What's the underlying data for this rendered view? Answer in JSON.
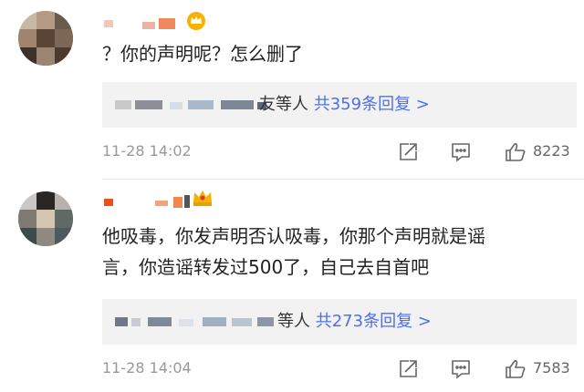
{
  "comments": [
    {
      "text_lines": [
        "？你的声明呢？怎么删了"
      ],
      "reply": {
        "partial_text": "友等人",
        "count_text": "共359条回复 >"
      },
      "timestamp": "11-28 14:02",
      "likes": "8223",
      "icons": {
        "share": "share-icon",
        "comment": "comment-icon",
        "like": "like-icon"
      }
    },
    {
      "text_lines": [
        "他吸毒，你发声明否认吸毒，你那个声明就是谣",
        "言，你造谣转发过500了，自己去自首吧"
      ],
      "reply": {
        "partial_text": "等人",
        "count_text": "共273条回复 >"
      },
      "timestamp": "11-28 14:04",
      "likes": "7583",
      "icons": {
        "share": "share-icon",
        "comment": "comment-icon",
        "like": "like-icon"
      }
    }
  ],
  "colors": {
    "link": "#4e6ef2",
    "text": "#222222",
    "meta": "#999999",
    "reply_bg": "#f2f2f2"
  }
}
